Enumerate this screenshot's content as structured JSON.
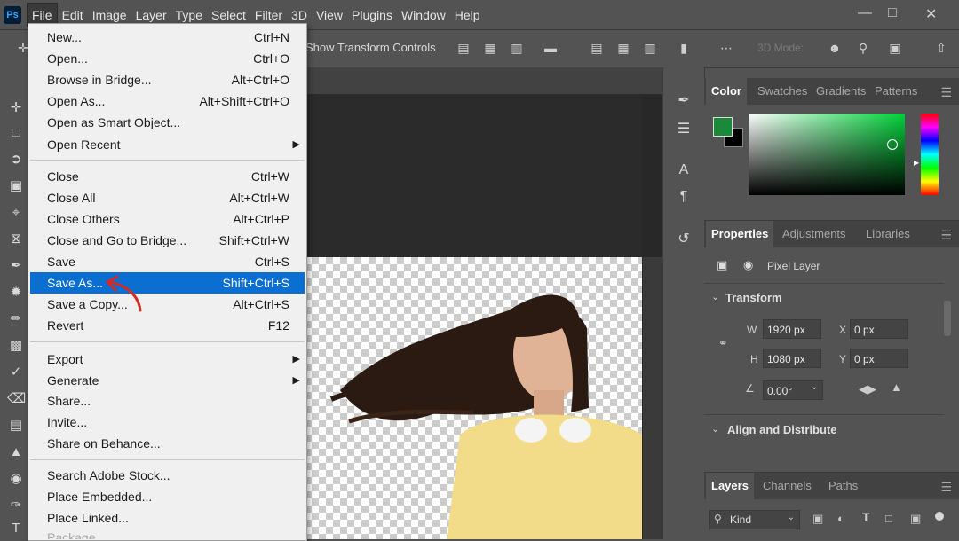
{
  "menubar": {
    "logo": "Ps",
    "items": [
      "File",
      "Edit",
      "Image",
      "Layer",
      "Type",
      "Select",
      "Filter",
      "3D",
      "View",
      "Plugins",
      "Window",
      "Help"
    ]
  },
  "options_bar": {
    "transform_label": "Show Transform Controls",
    "mode_label": "3D Mode:"
  },
  "file_menu": {
    "items": [
      {
        "label": "New...",
        "shortcut": "Ctrl+N"
      },
      {
        "label": "Open...",
        "shortcut": "Ctrl+O"
      },
      {
        "label": "Browse in Bridge...",
        "shortcut": "Alt+Ctrl+O"
      },
      {
        "label": "Open As...",
        "shortcut": "Alt+Shift+Ctrl+O"
      },
      {
        "label": "Open as Smart Object...",
        "shortcut": ""
      },
      {
        "label": "Open Recent",
        "shortcut": ""
      },
      {
        "label": "Close",
        "shortcut": "Ctrl+W"
      },
      {
        "label": "Close All",
        "shortcut": "Alt+Ctrl+W"
      },
      {
        "label": "Close Others",
        "shortcut": "Alt+Ctrl+P"
      },
      {
        "label": "Close and Go to Bridge...",
        "shortcut": "Shift+Ctrl+W"
      },
      {
        "label": "Save",
        "shortcut": "Ctrl+S"
      },
      {
        "label": "Save As...",
        "shortcut": "Shift+Ctrl+S"
      },
      {
        "label": "Save a Copy...",
        "shortcut": "Alt+Ctrl+S"
      },
      {
        "label": "Revert",
        "shortcut": "F12"
      },
      {
        "label": "Export",
        "shortcut": ""
      },
      {
        "label": "Generate",
        "shortcut": ""
      },
      {
        "label": "Share...",
        "shortcut": ""
      },
      {
        "label": "Invite...",
        "shortcut": ""
      },
      {
        "label": "Share on Behance...",
        "shortcut": ""
      },
      {
        "label": "Search Adobe Stock...",
        "shortcut": ""
      },
      {
        "label": "Place Embedded...",
        "shortcut": ""
      },
      {
        "label": "Place Linked...",
        "shortcut": ""
      },
      {
        "label": "Package...",
        "shortcut": ""
      }
    ]
  },
  "color_panel": {
    "tabs": [
      "Color",
      "Swatches",
      "Gradients",
      "Patterns"
    ],
    "foreground": "#1a8a3a",
    "background": "#000000"
  },
  "properties_panel": {
    "tabs": [
      "Properties",
      "Adjustments",
      "Libraries"
    ],
    "layer_type": "Pixel Layer",
    "transform_title": "Transform",
    "w_label": "W",
    "w_value": "1920 px",
    "h_label": "H",
    "h_value": "1080 px",
    "x_label": "X",
    "x_value": "0 px",
    "y_label": "Y",
    "y_value": "0 px",
    "angle_value": "0.00°",
    "align_title": "Align and Distribute"
  },
  "layers_panel": {
    "tabs": [
      "Layers",
      "Channels",
      "Paths"
    ],
    "filter_label": "Kind"
  }
}
